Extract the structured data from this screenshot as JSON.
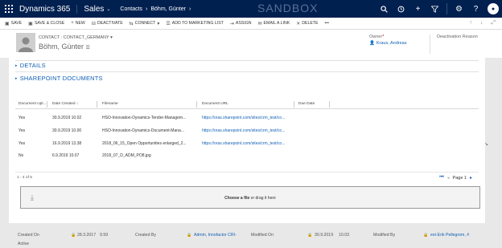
{
  "topbar": {
    "brand": "Dynamics 365",
    "app": "Sales",
    "breadcrumb": [
      "Contacts",
      "Böhm, Günter"
    ],
    "environment": "SANDBOX",
    "icons": [
      "search-icon",
      "history-icon",
      "plus-icon",
      "filter-icon",
      "gear-icon",
      "help-icon"
    ]
  },
  "commandbar": {
    "items": [
      {
        "icon": "save-icon",
        "label": "SAVE"
      },
      {
        "icon": "save-close-icon",
        "label": "SAVE & CLOSE"
      },
      {
        "icon": "plus-icon",
        "label": "NEW"
      },
      {
        "icon": "deactivate-icon",
        "label": "DEACTIVATE"
      },
      {
        "icon": "connect-icon",
        "label": "CONNECT"
      },
      {
        "icon": "marketing-list-icon",
        "label": "ADD TO MARKETING LIST"
      },
      {
        "icon": "assign-icon",
        "label": "ASSIGN"
      },
      {
        "icon": "email-link-icon",
        "label": "EMAIL A LINK"
      },
      {
        "icon": "delete-icon",
        "label": "DELETE"
      },
      {
        "icon": "more-icon",
        "label": "•••"
      }
    ]
  },
  "header": {
    "record_type": "CONTACT : CONTACT_GERMANY",
    "record_name": "Böhm, Günter",
    "owner_label": "Owner",
    "owner_required": "*",
    "owner_value": "Kraus, Andreas",
    "deactivation_label": "Deactivation Reason"
  },
  "sections": {
    "details": "DETAILS",
    "sharepoint": "SHAREPOINT DOCUMENTS"
  },
  "grid": {
    "columns": [
      "Document Upl...",
      "Date Created ↓",
      "Filename",
      "Document URL",
      "Due Date"
    ],
    "rows": [
      {
        "uploaded": "Yes",
        "date": "30.9.2019 10.02",
        "filename": "HSO-Innovation-Dynamics-Tender-Managem...",
        "url": "https://oras.sharepoint.com/sites/crm_test/co..."
      },
      {
        "uploaded": "Yes",
        "date": "30.9.2019 10.00",
        "filename": "HSO-Innovation-Dynamics-Document-Mana...",
        "url": "https://oras.sharepoint.com/sites/crm_test/co..."
      },
      {
        "uploaded": "Yes",
        "date": "16.9.2019 13.38",
        "filename": "2018_06_15_Open Opportunities enlarged_2...",
        "url": "https://oras.sharepoint.com/sites/crm_test/co..."
      },
      {
        "uploaded": "No",
        "date": "6.9.2019 10.07",
        "filename": "2018_07_D_ADM_PO8.jpg",
        "url": ""
      }
    ],
    "count": "1 - 4 of 5",
    "page_label": "Page 1"
  },
  "dropzone": {
    "bold": "Choose a file",
    "rest": " or drag it here"
  },
  "footer": {
    "created_on_label": "Created On",
    "created_on_date": "28.3.2017",
    "created_on_time": "9.59",
    "created_by_label": "Created By",
    "created_by_value": "Admin, Innofactor CRI-",
    "modified_on_label": "Modified On",
    "modified_on_date": "30.9.2019",
    "modified_on_time": "10.03",
    "modified_by_label": "Modified By",
    "modified_by_value": "ext-Erik Pellegrom, #"
  },
  "status": "Active"
}
